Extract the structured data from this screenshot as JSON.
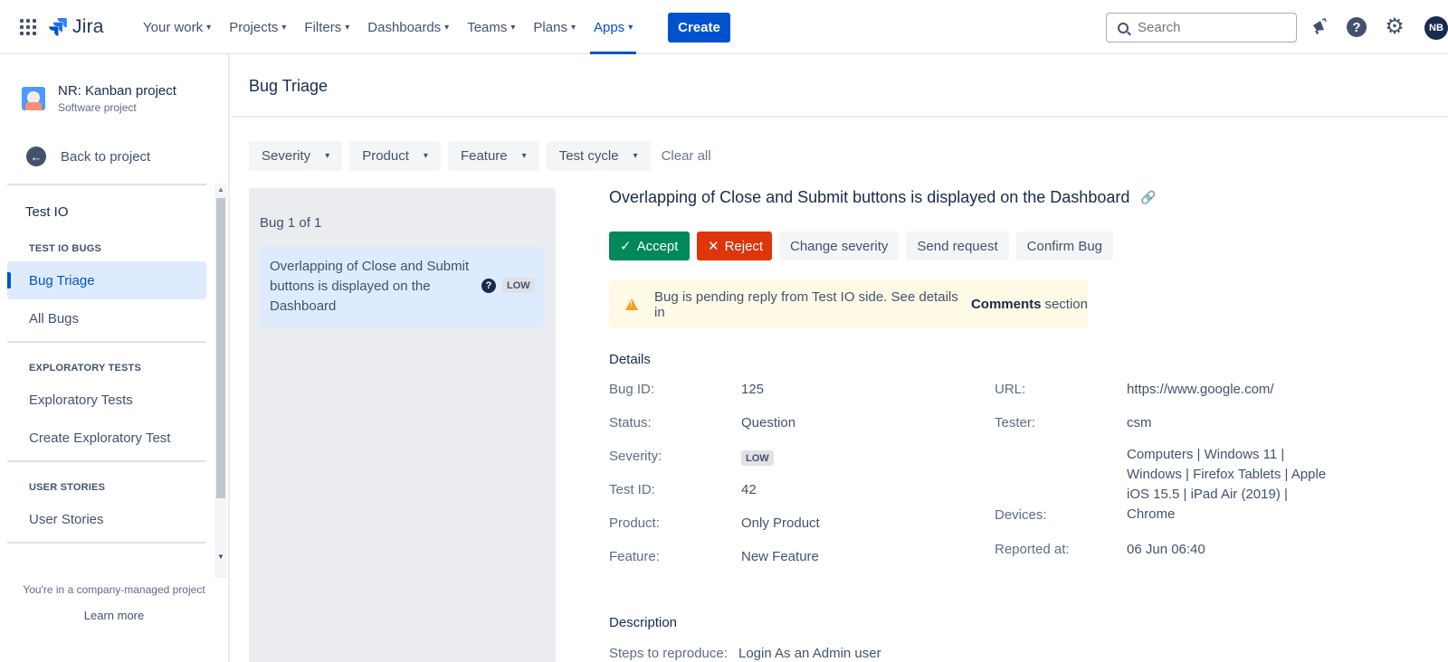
{
  "topbar": {
    "app_name": "Jira",
    "nav": [
      {
        "label": "Your work"
      },
      {
        "label": "Projects"
      },
      {
        "label": "Filters"
      },
      {
        "label": "Dashboards"
      },
      {
        "label": "Teams"
      },
      {
        "label": "Plans"
      },
      {
        "label": "Apps"
      }
    ],
    "create_label": "Create",
    "search_placeholder": "Search",
    "avatar_initials": "NB"
  },
  "sidebar": {
    "project_name": "NR: Kanban project",
    "project_type": "Software project",
    "back_label": "Back to project",
    "app_title": "Test IO",
    "sections": [
      {
        "title": "TEST IO BUGS",
        "items": [
          "Bug Triage",
          "All Bugs"
        ]
      },
      {
        "title": "EXPLORATORY TESTS",
        "items": [
          "Exploratory Tests",
          "Create Exploratory Test"
        ]
      },
      {
        "title": "USER STORIES",
        "items": [
          "User Stories"
        ]
      }
    ],
    "footer_text": "You're in a company-managed project",
    "learn_more": "Learn more"
  },
  "main": {
    "page_title": "Bug Triage",
    "filters": [
      "Severity",
      "Product",
      "Feature",
      "Test cycle"
    ],
    "clear_all": "Clear all",
    "bug_count": "Bug 1 of 1",
    "bug_card": {
      "title": "Overlapping of Close and Submit buttons is displayed on the Dashboard",
      "severity": "LOW"
    }
  },
  "detail": {
    "title": "Overlapping of Close and Submit buttons is displayed on the Dashboard",
    "actions": {
      "accept": "Accept",
      "reject": "Reject",
      "change_severity": "Change severity",
      "send_request": "Send request",
      "confirm_bug": "Confirm Bug"
    },
    "warning": {
      "text_before": "Bug is pending reply from Test IO side. See details in",
      "bold": "Comments",
      "text_after": "section"
    },
    "details_heading": "Details",
    "left_fields": [
      {
        "label": "Bug ID:",
        "value": "125"
      },
      {
        "label": "Status:",
        "value": "Question"
      },
      {
        "label": "Severity:",
        "value": "LOW"
      },
      {
        "label": "Test ID:",
        "value": "42"
      },
      {
        "label": "Product:",
        "value": "Only Product"
      },
      {
        "label": "Feature:",
        "value": "New Feature"
      }
    ],
    "right_fields": {
      "url_label": "URL:",
      "url_value": "https://www.google.com/",
      "tester_label": "Tester:",
      "tester_value": "csm",
      "devices_label": "Devices:",
      "devices_value": "Computers | Windows 11 | Windows | Firefox Tablets | Apple iOS 15.5 | iPad Air (2019) | Chrome",
      "reported_label": "Reported at:",
      "reported_value": "06 Jun 06:40"
    },
    "description_heading": "Description",
    "steps_label": "Steps to reproduce:",
    "steps_value": "Login As an Admin user"
  },
  "colors": {
    "brand": "#0052cc",
    "accept": "#00875a",
    "reject": "#de350b",
    "warning_bg": "#fffae6",
    "selected_bg": "#deebff"
  }
}
